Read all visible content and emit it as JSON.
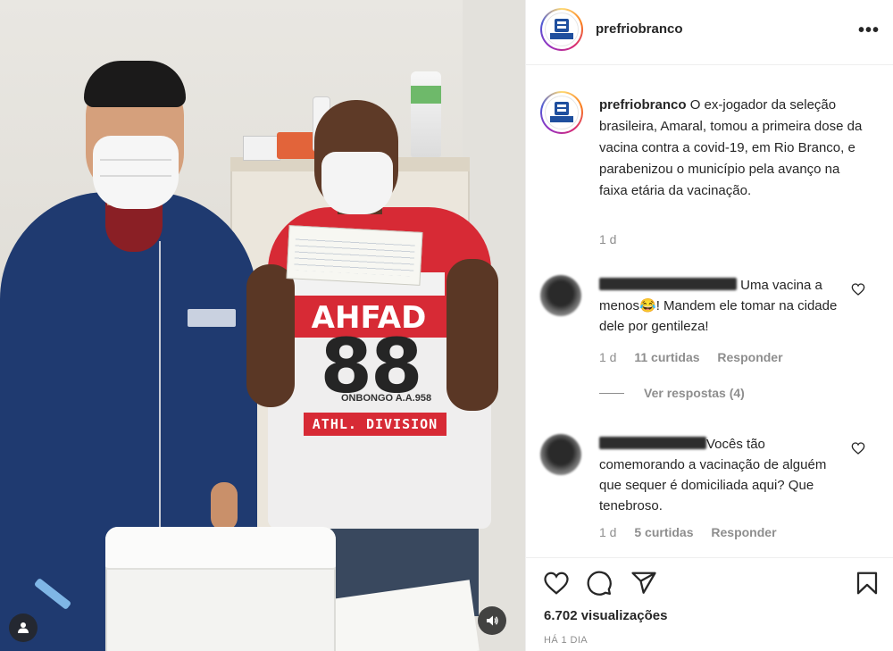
{
  "post": {
    "account": "prefriobranco",
    "more_label": "•••",
    "caption_username": "prefriobranco",
    "caption_text": "O ex-jogador da seleção brasileira, Amaral, tomou a primeira dose da vacina contra a covid-19, em Rio Branco, e parabenizou o município pela avanço na faixa etária da vacinação.",
    "caption_time": "1 d",
    "views": "6.702 visualizações",
    "posted_ago": "HÁ 1 DIA"
  },
  "photo": {
    "shirt_print_top": "AHFAD",
    "shirt_number": "88",
    "shirt_text": "ONBONGO A.A.958",
    "shirt_strip": "ATHL. DIVISION"
  },
  "comments": [
    {
      "text": " Uma vacina a menos😂! Mandem ele tomar na cidade dele por gentileza!",
      "time": "1 d",
      "likes": "11 curtidas",
      "reply_label": "Responder",
      "view_replies": "Ver respostas (4)"
    },
    {
      "text": "Vocês tão comemorando a vacinação de alguém que sequer é domiciliada aqui? Que tenebroso.",
      "time": "1 d",
      "likes": "5 curtidas",
      "reply_label": "Responder"
    }
  ],
  "icons": {
    "like": "heart-icon",
    "comment": "comment-icon",
    "share": "paper-plane-icon",
    "save": "bookmark-icon",
    "more": "more-options-icon",
    "user_tag": "user-tag-icon",
    "sound": "sound-icon"
  },
  "colors": {
    "text": "#262626",
    "secondary": "#8e8e8e",
    "border": "#efefef"
  }
}
